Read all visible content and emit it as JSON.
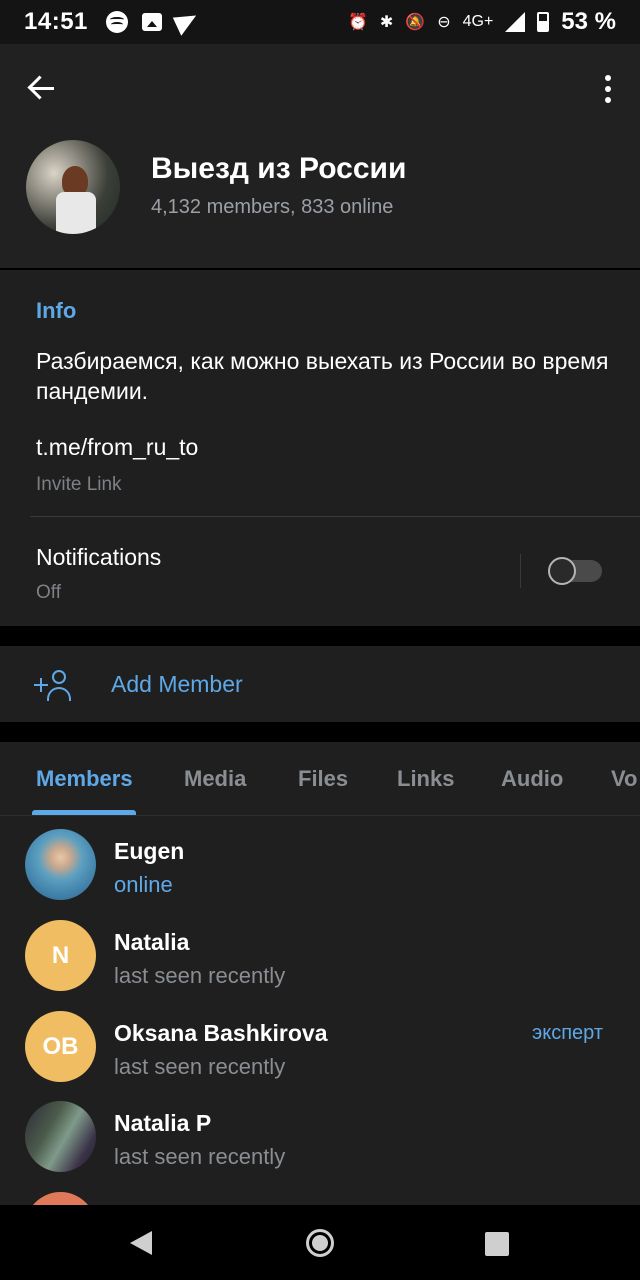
{
  "status_bar": {
    "time": "14:51",
    "network": "4G+",
    "battery_percent": "53 %",
    "battery_level": 0.53,
    "icons": [
      "spotify-icon",
      "gallery-icon",
      "telegram-icon",
      "alarm-icon",
      "bluetooth-icon",
      "mute-icon",
      "dnd-icon",
      "signal-icon",
      "battery-icon"
    ]
  },
  "header": {
    "title": "Выезд из России",
    "subtitle": "4,132 members, 833 online"
  },
  "info": {
    "heading": "Info",
    "description": "Разбираемся, как можно выехать из России во время пандемии.",
    "link": "t.me/from_ru_to",
    "link_label": "Invite Link",
    "notifications_title": "Notifications",
    "notifications_status": "Off",
    "notifications_enabled": false
  },
  "add_member": {
    "label": "Add Member"
  },
  "tabs": [
    "Members",
    "Media",
    "Files",
    "Links",
    "Audio",
    "Vo"
  ],
  "active_tab": "Members",
  "members": [
    {
      "name": "Eugen",
      "status": "online",
      "role": ""
    },
    {
      "name": "Natalia",
      "initials": "N",
      "status": "last seen recently",
      "role": ""
    },
    {
      "name": "Oksana Bashkirova",
      "initials": "OB",
      "status": "last seen recently",
      "role": "эксперт"
    },
    {
      "name": "Natalia P",
      "status": "last seen recently",
      "role": ""
    }
  ],
  "colors": {
    "accent": "#5fa8e8",
    "background": "#1f1f1f",
    "header": "#212121",
    "initials_avatar": "#f0bd62"
  }
}
